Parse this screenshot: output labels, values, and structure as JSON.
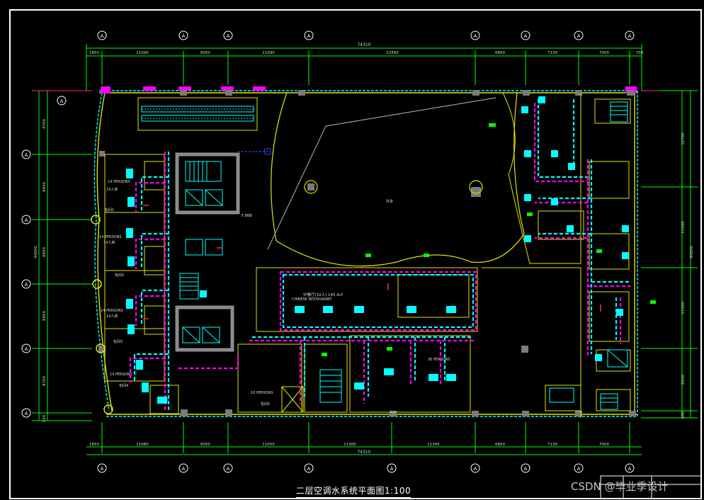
{
  "drawing": {
    "title": "二层空调水系统平面图1:100",
    "watermark": "CSDN @毕业季设计",
    "overall_dim_top": "74310",
    "overall_dim_bottom": "74310",
    "top_dims": [
      "1850",
      "11090",
      "6050",
      "11090",
      "22560",
      "6800",
      "7130",
      "7000",
      "700"
    ],
    "bottom_dims": [
      "1850",
      "11080",
      "6050",
      "11050",
      "11300",
      "11300",
      "6800",
      "7130",
      "7000"
    ],
    "left_dims": [
      "4700",
      "8400",
      "8800",
      "8800",
      "8700",
      "320"
    ],
    "left_total": "44500",
    "right_dims": [
      "12700",
      "11000",
      "11000",
      "8200",
      "650"
    ],
    "right_total": "44500",
    "grid_bubble_label": "A",
    "elev_label": "7.000",
    "room_labels": {
      "restaurant": "中餐厅(32人)  145.4㎡",
      "restaurant_en": "CHINESE RESTAURANT",
      "persons_14a": "14 PERSONS",
      "persons_14a_cn": "14人房",
      "persons_14b": "14 PERSONS",
      "persons_14b_cn": "14人房",
      "persons_14c": "14 PERSONS",
      "persons_14c_cn": "14人房",
      "persons_14d": "14 PERSONS",
      "persons_10": "10 PERSONS",
      "persons_30": "30 PERSONS",
      "room_1": "包间1",
      "room_2": "包间2",
      "room_3": "包间3",
      "room_4": "包间4",
      "room_5": "包间5",
      "atrium": "共享"
    }
  }
}
